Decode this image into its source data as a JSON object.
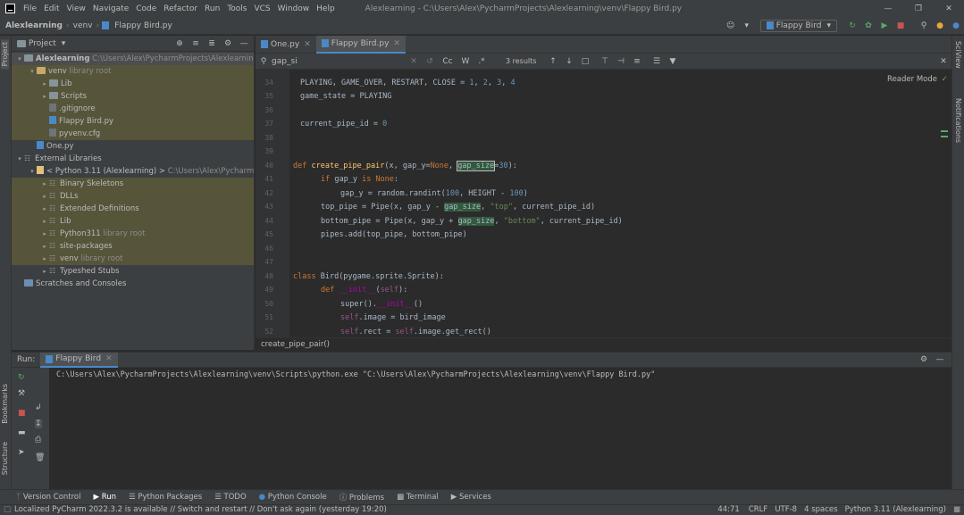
{
  "menubar": {
    "items": [
      "File",
      "Edit",
      "View",
      "Navigate",
      "Code",
      "Refactor",
      "Run",
      "Tools",
      "VCS",
      "Window",
      "Help"
    ],
    "title": "Alexlearning - C:\\Users\\Alex\\PycharmProjects\\Alexlearning\\venv\\Flappy Bird.py"
  },
  "navbar": {
    "crumbs": [
      "Alexlearning",
      "venv",
      "Flappy Bird.py"
    ],
    "run_config": "Flappy Bird"
  },
  "project": {
    "title": "Project",
    "tree": [
      {
        "label": "Alexlearning",
        "extra": "C:\\Users\\Alex\\PycharmProjects\\Alexlearning"
      },
      {
        "label": "venv",
        "extra": "library root"
      },
      {
        "label": "Lib",
        "extra": ""
      },
      {
        "label": "Scripts",
        "extra": ""
      },
      {
        "label": ".gitignore",
        "extra": ""
      },
      {
        "label": "Flappy Bird.py",
        "extra": ""
      },
      {
        "label": "pyvenv.cfg",
        "extra": ""
      },
      {
        "label": "One.py",
        "extra": ""
      },
      {
        "label": "External Libraries",
        "extra": ""
      },
      {
        "label": "< Python 3.11 (Alexlearning) >",
        "extra": "C:\\Users\\Alex\\PycharmP"
      },
      {
        "label": "Binary Skeletons",
        "extra": ""
      },
      {
        "label": "DLLs",
        "extra": ""
      },
      {
        "label": "Extended Definitions",
        "extra": ""
      },
      {
        "label": "Lib",
        "extra": ""
      },
      {
        "label": "Python311",
        "extra": "library root"
      },
      {
        "label": "site-packages",
        "extra": ""
      },
      {
        "label": "venv",
        "extra": "library root"
      },
      {
        "label": "Typeshed Stubs",
        "extra": ""
      },
      {
        "label": "Scratches and Consoles",
        "extra": ""
      }
    ]
  },
  "editor": {
    "tabs": [
      "One.py",
      "Flappy Bird.py"
    ],
    "find_query": "gap_si",
    "find_results": "3 results",
    "find_opts": [
      "Cc",
      "W",
      ".*"
    ],
    "reader_mode": "Reader Mode",
    "breadcrumb": "create_pipe_pair()",
    "line_numbers": [
      "34",
      "35",
      "36",
      "37",
      "38",
      "39",
      "40",
      "41",
      "42",
      "43",
      "44",
      "45",
      "46",
      "47",
      "48",
      "49",
      "50",
      "51",
      "52"
    ]
  },
  "run": {
    "label": "Run:",
    "tab": "Flappy Bird",
    "output": "C:\\Users\\Alex\\PycharmProjects\\Alexlearning\\venv\\Scripts\\python.exe \"C:\\Users\\Alex\\PycharmProjects\\Alexlearning\\venv\\Flappy Bird.py\""
  },
  "side_tabs": {
    "left_top": "Project",
    "left_mid": "Bookmarks",
    "left_bot": "Structure",
    "right_top": "SciView",
    "right_bot": "Notifications"
  },
  "toolwindows": [
    "Version Control",
    "Run",
    "Python Packages",
    "TODO",
    "Python Console",
    "Problems",
    "Terminal",
    "Services"
  ],
  "status": {
    "message": "Localized PyCharm 2022.3.2 is available // Switch and restart // Don't ask again (yesterday 19:20)",
    "position": "44:71",
    "line_sep": "CRLF",
    "encoding": "UTF-8",
    "indent": "4 spaces",
    "interpreter": "Python 3.11 (Alexlearning)"
  },
  "colors": {
    "accent": "#4a88c7",
    "keyword": "#cc7832",
    "string": "#6a8759",
    "number": "#6897bb"
  }
}
